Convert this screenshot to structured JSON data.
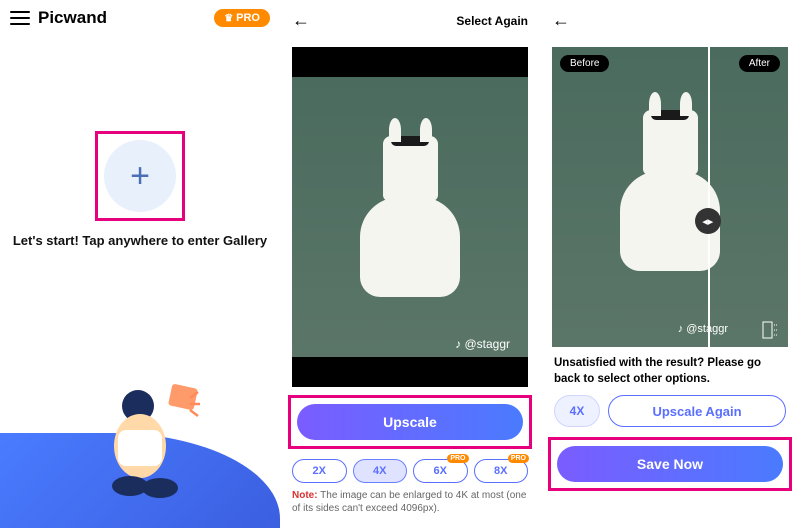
{
  "panel1": {
    "app_title": "Picwand",
    "pro_label": "PRO",
    "start_text": "Let's start! Tap anywhere to enter Gallery"
  },
  "panel2": {
    "select_again": "Select Again",
    "watermark": "♪ @staggr",
    "upscale_label": "Upscale",
    "scales": [
      "2X",
      "4X",
      "6X",
      "8X"
    ],
    "pro_tag": "PRO",
    "note_prefix": "Note:",
    "note_text": " The image can be enlarged to 4K at most (one of its sides can't exceed 4096px)."
  },
  "panel3": {
    "before": "Before",
    "after": "After",
    "watermark": "♪ @staggr",
    "unsatisfied": "Unsatisfied with the result? Please go back to select other options.",
    "chip": "4X",
    "upscale_again": "Upscale Again",
    "save_now": "Save Now"
  }
}
